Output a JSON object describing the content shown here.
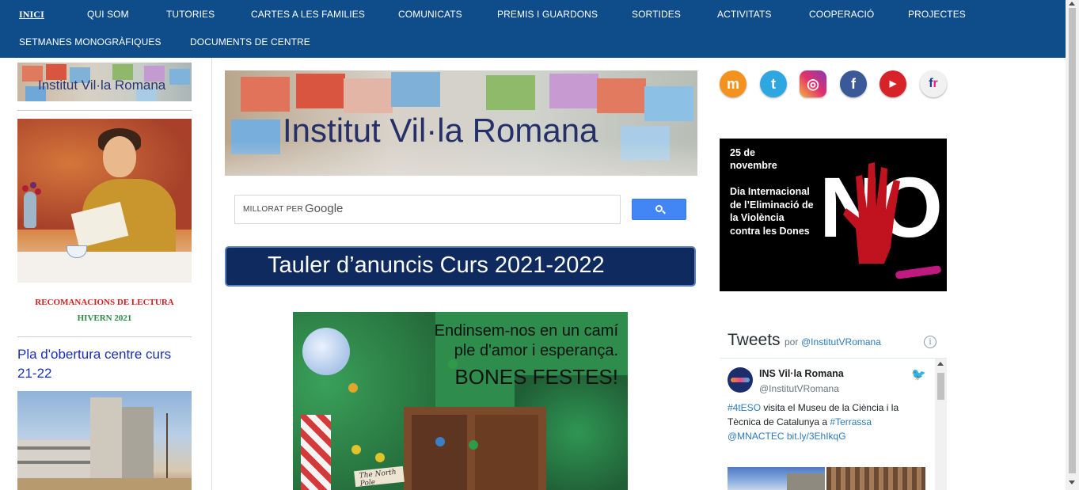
{
  "nav": {
    "row1": [
      "INICI",
      "QUI SOM",
      "TUTORIES",
      "CARTES A LES FAMILIES",
      "COMUNICATS",
      "PREMIS I GUARDONS",
      "SORTIDES",
      "ACTIVITATS",
      "COOPERACIÓ",
      "PROJECTES"
    ],
    "row2": [
      "SETMANES MONOGRÀFIQUES",
      "DOCUMENTS DE CENTRE"
    ],
    "active": "INICI"
  },
  "left": {
    "banner_text": "Institut Vil·la Romana",
    "recommend_line1": "RECOMANACIONS DE LECTURA",
    "recommend_line2": "HIVERN 2021",
    "plan_link": "Pla d'obertura centre curs 21-22"
  },
  "center": {
    "banner_text": "Institut Vil·la Romana",
    "search": {
      "enhanced_by": "MILLORAT PER",
      "provider": "Google",
      "button_icon": "search-icon"
    },
    "board_title": "Tauler d’anuncis Curs 2021-2022",
    "xmas": {
      "line1": "Endinsem-nos en un camí",
      "line2": "ple d'amor i esperança.",
      "line3": "BONES FESTES!",
      "sign": "The North Pole"
    }
  },
  "right": {
    "social": [
      "moodle-icon",
      "twitter-icon",
      "instagram-icon",
      "facebook-icon",
      "youtube-icon",
      "flickr-icon"
    ],
    "violence": {
      "date": "25 de novembre",
      "text": "Dia Internacional de l’Eliminació de la Violència contra les Dones",
      "big": "NO"
    },
    "tweets": {
      "title": "Tweets",
      "por": "por",
      "handle": "@InstitutVRomana",
      "info": "i",
      "account_name": "INS Vil·la Romana",
      "account_handle": "@InstitutVRomana",
      "tweet_hashtag1": "#4tESO",
      "tweet_text1": " visita el Museu de la Ciència i la Tècnica de Catalunya a ",
      "tweet_hashtag2": "#Terrassa",
      "tweet_mention": "@MNACTEC",
      "tweet_link": "bit.ly/3EhIkqG"
    }
  },
  "colors": {
    "nav_bg": "#0e4c8a",
    "link_blue": "#1a2fb8",
    "red_text": "#d21f1f",
    "green_text": "#2b8a3e",
    "tauler_bg": "#0f2a5e",
    "google_blue": "#4285f4"
  }
}
